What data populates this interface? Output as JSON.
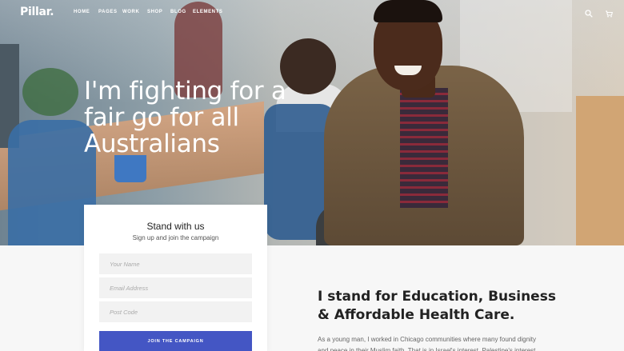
{
  "brand": {
    "logo": "Pillar."
  },
  "nav": {
    "items": [
      "HOME",
      "PAGES",
      "WORK",
      "SHOP",
      "BLOG",
      "ELEMENTS"
    ],
    "icons": [
      "search-icon",
      "cart-icon"
    ]
  },
  "hero": {
    "headline": "I'm fighting for a fair go for all Australians"
  },
  "signup": {
    "title": "Stand with us",
    "subtitle": "Sign up and join the campaign",
    "name_placeholder": "Your Name",
    "email_placeholder": "Email Address",
    "postcode_placeholder": "Post Code",
    "button_label": "JOIN THE CAMPAIGN"
  },
  "content": {
    "title": "I stand for Education, Business & Affordable Health Care.",
    "body": "As a young man, I worked in Chicago communities where many found dignity and peace in their Muslim faith. That is in Israel's interest, Palestine's interest"
  },
  "colors": {
    "accent": "#4456c4",
    "text": "#222222",
    "background": "#f7f7f7"
  }
}
